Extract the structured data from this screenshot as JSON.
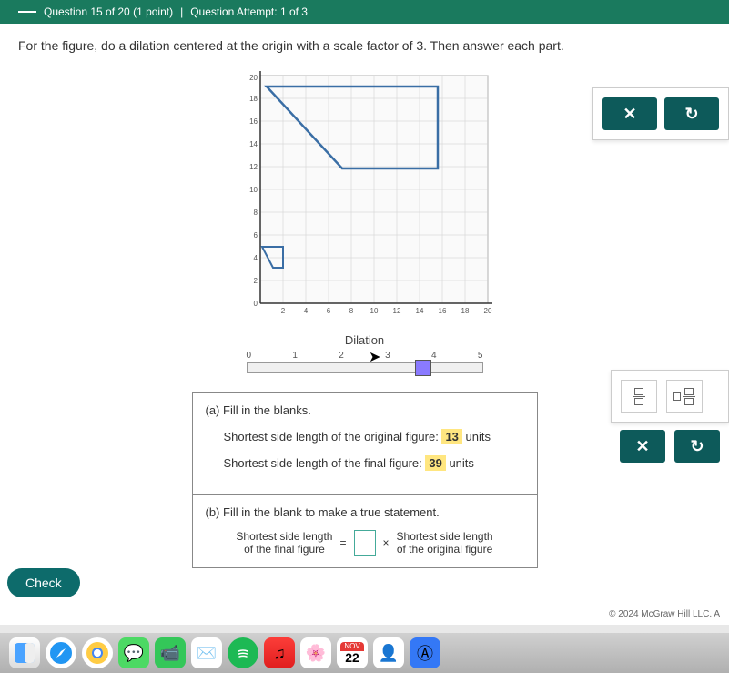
{
  "header": {
    "question_info": "Question 15 of 20 (1 point)",
    "attempt_info": "Question Attempt: 1 of 3"
  },
  "question": {
    "prompt": "For the figure, do a dilation centered at the origin with a scale factor of 3. Then answer each part."
  },
  "graph": {
    "x_ticks": [
      "0",
      "2",
      "4",
      "6",
      "8",
      "10",
      "12",
      "14",
      "16",
      "18",
      "20"
    ],
    "y_ticks": [
      "2",
      "4",
      "6",
      "8",
      "10",
      "12",
      "14",
      "16",
      "18",
      "20"
    ]
  },
  "dilation": {
    "label": "Dilation",
    "ticks": [
      "0",
      "1",
      "2",
      "3",
      "4",
      "5"
    ],
    "value": 4
  },
  "controls": {
    "close": "✕",
    "reset": "↻"
  },
  "part_a": {
    "label": "(a)  Fill in the blanks.",
    "line1_prefix": "Shortest side length of the original figure: ",
    "line1_value": "13",
    "line1_suffix": " units",
    "line2_prefix": "Shortest side length of the final figure: ",
    "line2_value": "39",
    "line2_suffix": " units"
  },
  "part_b": {
    "label": "(b)  Fill in the blank to make a true statement.",
    "left_top": "Shortest side length",
    "left_bot": "of the final figure",
    "equals": "=",
    "times": "×",
    "right_top": "Shortest side length",
    "right_bot": "of the original figure"
  },
  "check_label": "Check",
  "copyright": "© 2024 McGraw Hill LLC. A",
  "calendar": {
    "month": "NOV",
    "day": "22"
  }
}
